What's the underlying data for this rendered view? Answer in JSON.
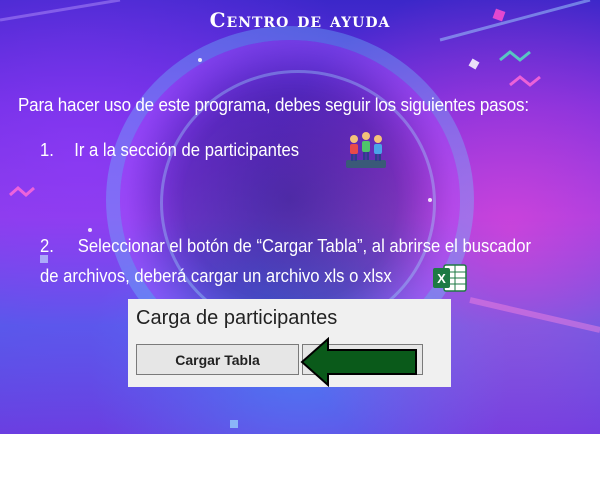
{
  "help": {
    "title": "Centro de ayuda",
    "intro": "Para hacer uso de este programa, debes seguir los siguientes pasos:",
    "steps": [
      {
        "number": "1.",
        "text": "Ir a la sección de participantes",
        "icon": "participants-icon"
      },
      {
        "number": "2.",
        "text_line1": "Seleccionar el botón de “Cargar Tabla”, al abrirse el buscador",
        "text_line2": "de archivos, deberá cargar un archivo xls o xlsx",
        "icon": "excel-icon"
      }
    ]
  },
  "example_panel": {
    "title": "Carga de participantes",
    "button_label": "Cargar Tabla",
    "arrow_color": "#0a5a1a"
  },
  "colors": {
    "banner_primary": "#6b2fe0",
    "banner_secondary": "#3b27c9",
    "text": "#ffffff",
    "panel_bg": "#f0f0f0"
  }
}
